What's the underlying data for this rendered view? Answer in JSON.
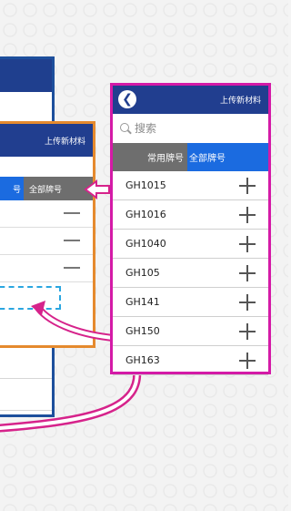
{
  "middle_panel": {
    "header_title": "上传新材料",
    "tab_partial": "号",
    "tab_all": "全部牌号"
  },
  "front_panel": {
    "header_title": "上传新材料",
    "back_glyph": "❮",
    "search_placeholder": "搜索",
    "tabs": [
      "常用牌号",
      "全部牌号"
    ],
    "items": [
      "GH1015",
      "GH1016",
      "GH1040",
      "GH105",
      "GH141",
      "GH150",
      "GH163"
    ]
  },
  "colors": {
    "header_blue": "#213e8f",
    "active_tab": "#1b6be0",
    "inactive_tab": "#6e6e6e",
    "front_border": "#d41aa7",
    "middle_border": "#e58a2e",
    "back_border": "#1d4f9c",
    "arrow": "#d6238b"
  }
}
